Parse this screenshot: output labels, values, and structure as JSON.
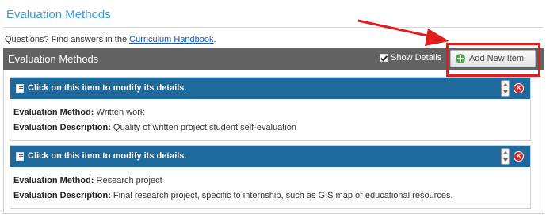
{
  "page": {
    "title": "Evaluation Methods",
    "help_prefix": "Questions? Find answers in the ",
    "help_link": "Curriculum Handbook",
    "help_suffix": "."
  },
  "section": {
    "title": "Evaluation Methods",
    "show_details_label": "Show Details",
    "show_details_checked": true,
    "add_button_label": "Add New Item"
  },
  "items": [
    {
      "header": "Click on this item to modify its details.",
      "method_label": "Evaluation Method:",
      "method_value": "Written work",
      "description_label": "Evaluation Description:",
      "description_value": "Quality of written project student self-evaluation"
    },
    {
      "header": "Click on this item to modify its details.",
      "method_label": "Evaluation Method:",
      "method_value": "Research project",
      "description_label": "Evaluation Description:",
      "description_value": "Final research project, specific to internship, such as GIS map or educational resources."
    }
  ],
  "colors": {
    "title": "#3a9ad9",
    "section_bar": "#636363",
    "item_header": "#1f6a9c",
    "annotation": "#e11d1d"
  },
  "icons": [
    "checkbox-checked-icon",
    "plus-circle-icon",
    "edit-icon",
    "reorder-arrows-icon",
    "delete-x-icon",
    "annotation-arrow"
  ]
}
